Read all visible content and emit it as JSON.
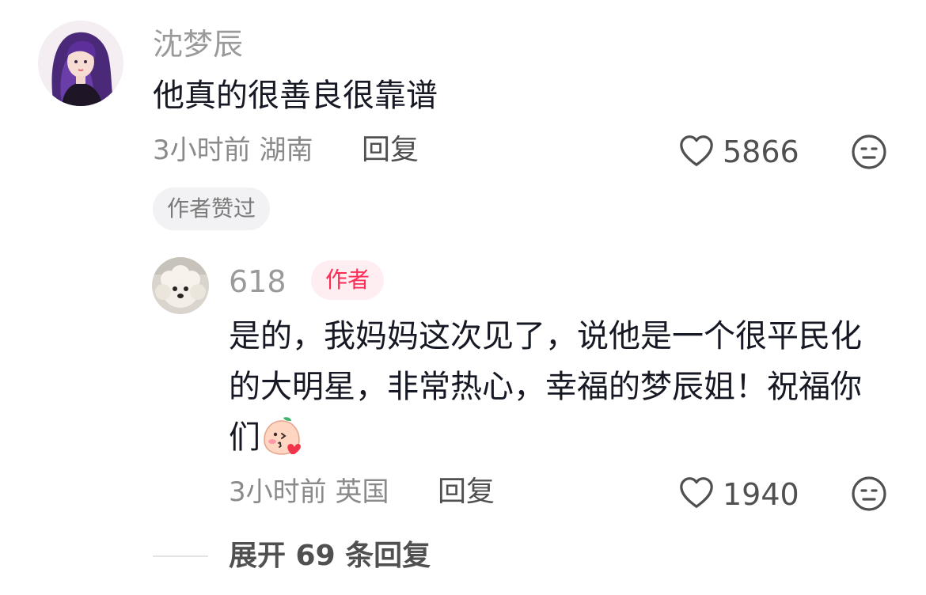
{
  "comment": {
    "username": "沈梦辰",
    "text": "他真的很善良很靠谱",
    "time_location": "3小时前 湖南",
    "reply_label": "回复",
    "likes": "5866",
    "liked_by_author_tag": "作者赞过",
    "heart_icon": "heart-outline-icon",
    "dislike_icon": "neutral-face-icon"
  },
  "reply": {
    "username": "618",
    "author_badge": "作者",
    "text_line1": "是的，我妈妈这次见了，说他是一个很平民化",
    "text_line2": "的大明星，非常热心，幸福的梦辰姐！祝福你",
    "text_line3": "们",
    "emoji": "blushing-peach-kiss-emoji",
    "time_location": "3小时前 英国",
    "reply_label": "回复",
    "likes": "1940"
  },
  "expand": {
    "label": "展开 69 条回复"
  }
}
